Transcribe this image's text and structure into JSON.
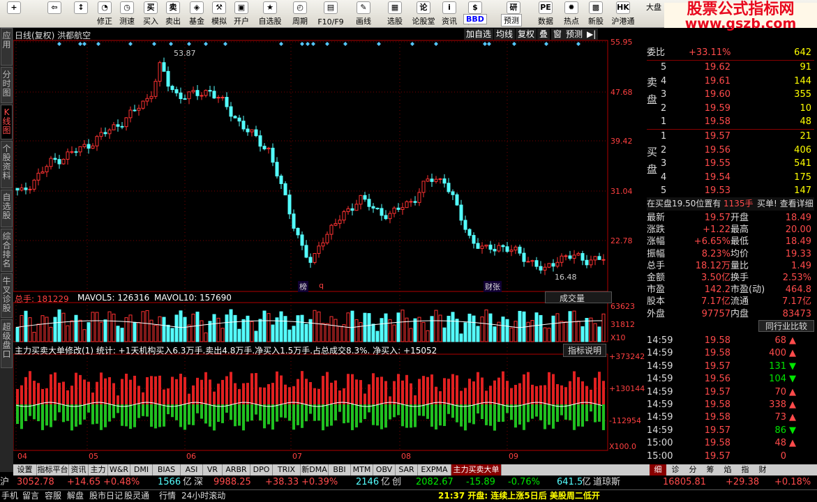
{
  "toolbar": [
    {
      "ic": "+",
      "label": "",
      "name": "grid-icon"
    },
    {
      "ic": "⇦",
      "label": "",
      "name": "back-arrow-icon"
    },
    {
      "ic": "↕",
      "label": "",
      "name": "updown-arrow-icon"
    },
    {
      "ic": "◔",
      "label": "修正",
      "name": "refresh-icon"
    },
    {
      "ic": "◷",
      "label": "测速",
      "name": "clock-icon"
    },
    {
      "ic": "买",
      "label": "买入",
      "name": "buy-icon"
    },
    {
      "ic": "卖",
      "label": "卖出",
      "name": "sell-icon"
    },
    {
      "ic": "◈",
      "label": "基金",
      "name": "fund-icon"
    },
    {
      "ic": "⚒",
      "label": "模拟",
      "name": "hammer-icon"
    },
    {
      "ic": "▣",
      "label": "开户",
      "name": "lock-icon"
    },
    {
      "ic": "★",
      "label": "自选股",
      "name": "star-icon"
    },
    {
      "ic": "◴",
      "label": "周期",
      "name": "period-icon"
    },
    {
      "ic": "▤",
      "label": "F10/F9",
      "name": "f10-icon"
    },
    {
      "ic": "✎",
      "label": "画线",
      "name": "pen-icon"
    },
    {
      "ic": "▦",
      "label": "选股",
      "name": "screen-icon"
    },
    {
      "ic": "论",
      "label": "论股堂",
      "name": "forum-icon"
    },
    {
      "ic": "i",
      "label": "资讯",
      "name": "info-icon"
    },
    {
      "ic": "$",
      "label": "资金",
      "name": "money-icon"
    },
    {
      "ic": "研",
      "label": "研报",
      "name": "report-icon"
    },
    {
      "ic": "PE",
      "label": "数据",
      "name": "data-icon"
    },
    {
      "ic": "✹",
      "label": "热点",
      "name": "hot-icon"
    },
    {
      "ic": "▩",
      "label": "新股",
      "name": "newstock-icon"
    },
    {
      "ic": "HK",
      "label": "沪港通",
      "name": "hk-icon"
    }
  ],
  "toolbar_extra": {
    "bbd": "BBD",
    "yuce": "预测",
    "dapan": "大盘"
  },
  "brand": {
    "line1": "股票公式指标网",
    "line2": "www.gszb.com"
  },
  "sidebar": [
    {
      "label": "应用"
    },
    {
      "label": "分时图"
    },
    {
      "label": "K线图"
    },
    {
      "label": "个股资料"
    },
    {
      "label": "自选股"
    },
    {
      "label": "综合排名"
    },
    {
      "label": "牛叉诊股"
    },
    {
      "label": "超级盘口"
    }
  ],
  "chart": {
    "title": "日线(复权) 洪都航空",
    "nav": [
      "加自选",
      "均线",
      "复权",
      "叠",
      "窗",
      "预测"
    ],
    "price_ticks": [
      "55.95",
      "47.68",
      "39.42",
      "31.04",
      "22.78"
    ],
    "high_label": "53.87",
    "low_label": "16.48",
    "events": [
      "榜",
      "q",
      "财张"
    ],
    "vol_header": {
      "total": "总手: 181229",
      "mavol5": "MAVOL5: 126316",
      "mavol10": "MAVOL10: 157690"
    },
    "vol_button": "成交量",
    "vol_ticks": [
      "63623",
      "31812",
      "X10"
    ],
    "ind_header": "主力买卖大单修改(1) 统计: +1天机构买入6.3万手.卖出4.8万手.净买入1.5万手.占总成交8.3%. 净买入: +15052",
    "ind_button": "指标说明",
    "ind_ticks": [
      "+373242",
      "+130144",
      "-112954",
      "X100.0"
    ],
    "months": [
      "04",
      "05",
      "06",
      "07",
      "08",
      "09"
    ]
  },
  "quote": {
    "weibi": {
      "label": "委比",
      "value": "+33.11%",
      "num": "642"
    },
    "sell_label": "卖盘",
    "buy_label": "买盘",
    "sell": [
      [
        "5",
        "19.62",
        "91"
      ],
      [
        "4",
        "19.61",
        "144"
      ],
      [
        "3",
        "19.60",
        "355"
      ],
      [
        "2",
        "19.59",
        "10"
      ],
      [
        "1",
        "19.58",
        "48"
      ]
    ],
    "buy": [
      [
        "1",
        "19.57",
        "21"
      ],
      [
        "2",
        "19.56",
        "406"
      ],
      [
        "3",
        "19.55",
        "541"
      ],
      [
        "4",
        "19.54",
        "175"
      ],
      [
        "5",
        "19.53",
        "147"
      ]
    ],
    "notice": {
      "text": "在买盘19.50位置有",
      "vol": "1135手",
      "tail": "买单! 查看详细"
    },
    "stats": [
      [
        "最新",
        "19.57",
        "开盘",
        "18.49"
      ],
      [
        "涨跌",
        "+1.22",
        "最高",
        "20.00"
      ],
      [
        "涨幅",
        "+6.65%",
        "最低",
        "18.49"
      ],
      [
        "振幅",
        "8.23%",
        "均价",
        "19.33"
      ],
      [
        "总手",
        "18.12万",
        "量比",
        "1.49"
      ],
      [
        "金额",
        "3.50亿",
        "换手",
        "2.53%"
      ],
      [
        "市盈",
        "142.2",
        "市盈(动)",
        "464.8"
      ],
      [
        "股本",
        "7.17亿",
        "流通",
        "7.17亿"
      ],
      [
        "外盘",
        "97757",
        "内盘",
        "83473"
      ]
    ],
    "compare_btn": "同行业比较",
    "ticks": [
      [
        "14:59",
        "19.58",
        "68",
        "up"
      ],
      [
        "14:59",
        "19.58",
        "400",
        "up"
      ],
      [
        "14:59",
        "19.57",
        "131",
        "down"
      ],
      [
        "14:59",
        "19.56",
        "104",
        "down"
      ],
      [
        "14:59",
        "19.57",
        "70",
        "up"
      ],
      [
        "14:59",
        "19.58",
        "338",
        "up"
      ],
      [
        "14:59",
        "19.58",
        "73",
        "up"
      ],
      [
        "14:59",
        "19.57",
        "86",
        "down"
      ],
      [
        "15:00",
        "19.58",
        "48",
        "up"
      ],
      [
        "15:00",
        "19.57",
        "0",
        ""
      ]
    ],
    "tabs": [
      "细",
      "诊",
      "分",
      "筹",
      "焰",
      "指",
      "财"
    ]
  },
  "bottom_tabs": [
    "设置",
    "指标平台",
    "资讯",
    "主力",
    "W&R",
    "DMI",
    "BIAS",
    "ASI",
    "VR",
    "ARBR",
    "DPO",
    "TRIX",
    "新DMA",
    "BBI",
    "MTM",
    "OBV",
    "SAR",
    "EXPMA",
    "主力买卖大单修改"
  ],
  "status": {
    "sh": {
      "label": "沪",
      "v": "3052.78",
      "c": "+14.65",
      "p": "+0.48%",
      "amt": "1566",
      "unit": "亿"
    },
    "sz": {
      "label": "深",
      "v": "9988.25",
      "c": "+38.33",
      "p": "+0.39%",
      "amt": "2146",
      "unit": "亿"
    },
    "cy": {
      "label": "创",
      "v": "2082.67",
      "c": "-15.89",
      "p": "-0.76%",
      "amt": "641.5",
      "unit": "亿"
    },
    "dj": {
      "label": "道琼斯",
      "v": "16805.81",
      "c": "+29.38",
      "p": "+0.18%"
    }
  },
  "status2": {
    "items": [
      "手机",
      "留言",
      "容服",
      "解盘",
      "股市日记",
      "股灵通",
      "行情",
      "24小时滚动"
    ],
    "news": "21:37 开盘: 连续上涨5日后 美股周二低开"
  },
  "colors": {
    "up": "#ff3232",
    "down": "#54ffff",
    "bg": "#000000",
    "grid": "#800000",
    "axis": "#b00000"
  }
}
